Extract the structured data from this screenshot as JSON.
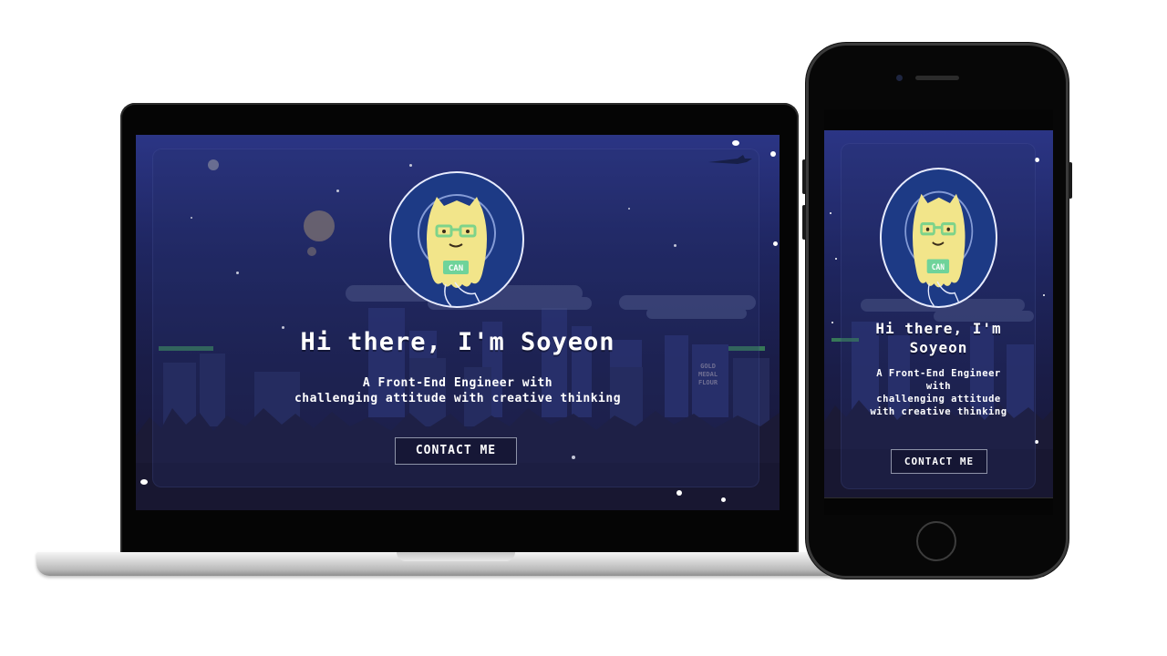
{
  "site": {
    "hero_title": "Hi there, I'm Soyeon",
    "hero_title_mobile": "Hi there, I'm\nSoyeon",
    "hero_subtitle": "A Front-End Engineer with\nchallenging attitude with creative thinking",
    "hero_subtitle_mobile": "A Front-End Engineer\nwith\nchallenging attitude\nwith creative thinking",
    "contact_label": "CONTACT ME",
    "badge_text": "CAN",
    "billboard_text": "GOLD\nMEDAL\nFLOUR"
  },
  "icons": {
    "avatar": "alien-astronaut-icon",
    "moon": "moon-icon",
    "plane": "airplane-icon"
  },
  "colors": {
    "sky_top": "#2b3585",
    "sky_bottom": "#171634",
    "avatar_bg": "#1d3a85",
    "creature": "#f2e58a",
    "glasses": "#7ed38a",
    "badge": "#6fd39a"
  }
}
